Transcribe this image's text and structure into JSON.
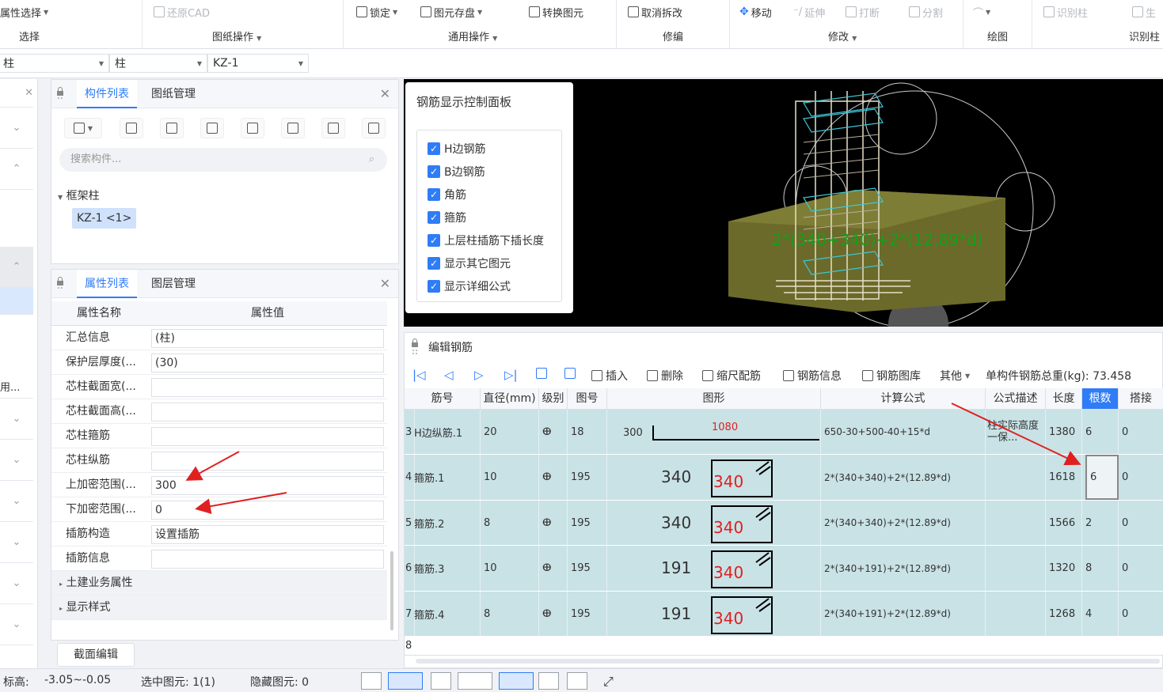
{
  "ribbon": {
    "groups": [
      {
        "label": "选择",
        "buttons": [
          {
            "text": "属性选择",
            "icon": "none",
            "dis": false
          }
        ]
      },
      {
        "label": "图纸操作",
        "buttons": [
          {
            "text": "还原CAD",
            "icon": "restore-cad-icon",
            "dis": true
          }
        ]
      },
      {
        "label": "通用操作",
        "buttons": [
          {
            "text": "锁定",
            "icon": "lock-icon",
            "dis": false
          },
          {
            "text": "图元存盘",
            "icon": "save-element-icon",
            "dis": false
          },
          {
            "text": "转换图元",
            "icon": "convert-icon",
            "dis": false
          }
        ]
      },
      {
        "label": "修编",
        "buttons": [
          {
            "text": "取消拆改",
            "icon": "cube-icon",
            "dis": false
          }
        ]
      },
      {
        "label": "修改",
        "buttons": [
          {
            "text": "移动",
            "icon": "move-icon",
            "dis": false
          },
          {
            "text": "延伸",
            "icon": "extend-icon",
            "dis": true
          },
          {
            "text": "打断",
            "icon": "break-icon",
            "dis": true
          },
          {
            "text": "分割",
            "icon": "split-icon",
            "dis": true
          }
        ]
      },
      {
        "label": "绘图",
        "buttons": [
          {
            "text": "",
            "icon": "arc-icon",
            "dis": true
          }
        ]
      },
      {
        "label": "识别柱",
        "buttons": [
          {
            "text": "识别柱",
            "icon": "identify-column-icon",
            "dis": true
          },
          {
            "text": "生",
            "icon": "generate-icon",
            "dis": true
          }
        ]
      }
    ]
  },
  "filters": {
    "f1": "柱",
    "f2": "柱",
    "f3": "KZ-1"
  },
  "component_panel": {
    "tab_active": "构件列表",
    "tab_other": "图纸管理",
    "search_placeholder": "搜索构件...",
    "tree_root": "框架柱",
    "tree_item": "KZ-1 <1>"
  },
  "property_panel": {
    "tab_active": "属性列表",
    "tab_other": "图层管理",
    "col_name": "属性名称",
    "col_value": "属性值",
    "rows": [
      {
        "name": "汇总信息",
        "value": "(柱)"
      },
      {
        "name": "保护层厚度(...",
        "value": "(30)"
      },
      {
        "name": "芯柱截面宽(...",
        "value": ""
      },
      {
        "name": "芯柱截面高(...",
        "value": ""
      },
      {
        "name": "芯柱箍筋",
        "value": ""
      },
      {
        "name": "芯柱纵筋",
        "value": ""
      },
      {
        "name": "上加密范围(...",
        "value": "300"
      },
      {
        "name": "下加密范围(...",
        "value": "0"
      },
      {
        "name": "插筋构造",
        "value": "设置插筋"
      },
      {
        "name": "插筋信息",
        "value": ""
      }
    ],
    "groups": [
      "土建业务属性",
      "显示样式"
    ],
    "section_edit_button": "截面编辑"
  },
  "left_strip": {
    "truncated_text": "用..."
  },
  "control_panel": {
    "title": "钢筋显示控制面板",
    "items": [
      "H边钢筋",
      "B边钢筋",
      "角筋",
      "箍筋",
      "上层柱插筋下插长度",
      "显示其它图元",
      "显示详细公式"
    ]
  },
  "view3d": {
    "formula_overlay": "2*(340+340)+2*(12.89*d)"
  },
  "edit_panel": {
    "title": "编辑钢筋",
    "toolbar": {
      "insert": "插入",
      "delete": "删除",
      "scale": "缩尺配筋",
      "info": "钢筋信息",
      "library": "钢筋图库",
      "other": "其他",
      "total": "单构件钢筋总重(kg): 73.458"
    },
    "headers": [
      "筋号",
      "直径(mm)",
      "级别",
      "图号",
      "图形",
      "计算公式",
      "公式描述",
      "长度",
      "根数",
      "搭接"
    ],
    "rows": [
      {
        "no": "3",
        "name": "H边纵筋.1",
        "dia": "20",
        "grade": "ⴲ",
        "fig": "18",
        "shapeA": "300",
        "shapeB": "1080",
        "formula": "650-30+500-40+15*d",
        "desc": "柱实际高度一保...",
        "len": "1380",
        "count": "6",
        "lap": "0"
      },
      {
        "no": "4",
        "name": "箍筋.1",
        "dia": "10",
        "grade": "ⴲ",
        "fig": "195",
        "shapeA": "340",
        "shapeB": "340",
        "formula": "2*(340+340)+2*(12.89*d)",
        "desc": "",
        "len": "1618",
        "count": "6",
        "lap": "0"
      },
      {
        "no": "5",
        "name": "箍筋.2",
        "dia": "8",
        "grade": "ⴲ",
        "fig": "195",
        "shapeA": "340",
        "shapeB": "340",
        "formula": "2*(340+340)+2*(12.89*d)",
        "desc": "",
        "len": "1566",
        "count": "2",
        "lap": "0"
      },
      {
        "no": "6",
        "name": "箍筋.3",
        "dia": "10",
        "grade": "ⴲ",
        "fig": "195",
        "shapeA": "191",
        "shapeB": "340",
        "formula": "2*(340+191)+2*(12.89*d)",
        "desc": "",
        "len": "1320",
        "count": "8",
        "lap": "0"
      },
      {
        "no": "7",
        "name": "箍筋.4",
        "dia": "8",
        "grade": "ⴲ",
        "fig": "195",
        "shapeA": "191",
        "shapeB": "340",
        "formula": "2*(340+191)+2*(12.89*d)",
        "desc": "",
        "len": "1268",
        "count": "4",
        "lap": "0"
      }
    ],
    "empty_row_no": "8"
  },
  "status": {
    "elevation_label": "标高:",
    "elevation_value": "-3.05~-0.05",
    "selected": "选中图元: 1(1)",
    "hidden": "隐藏图元: 0"
  },
  "colors": {
    "accent": "#2f7cf6",
    "row_bg": "#c9e2e6",
    "red_text": "#e02020",
    "green_text": "#1a9c1a"
  }
}
